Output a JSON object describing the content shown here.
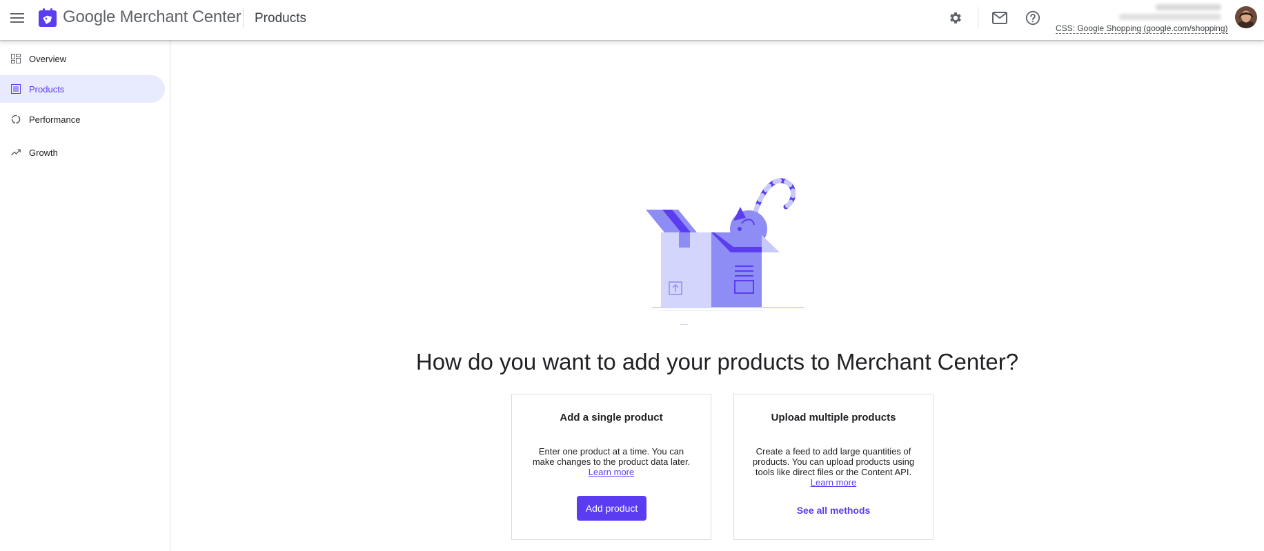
{
  "header": {
    "brand": "Google Merchant Center",
    "page_title": "Products",
    "account_css": "CSS: Google Shopping (google.com/shopping)"
  },
  "icons": {
    "menu": "menu-icon",
    "logo": "merchant-center-logo-icon",
    "settings": "gear-icon",
    "mail": "mail-icon",
    "help": "help-icon"
  },
  "sidebar": {
    "items": [
      {
        "label": "Overview",
        "icon": "dashboard-icon",
        "active": false
      },
      {
        "label": "Products",
        "icon": "list-icon",
        "active": true
      },
      {
        "label": "Performance",
        "icon": "donut-chart-icon",
        "active": false
      },
      {
        "label": "Growth",
        "icon": "trending-up-icon",
        "active": false
      }
    ]
  },
  "main": {
    "headline": "How do you want to add your products to Merchant Center?",
    "cards": [
      {
        "title": "Add a single product",
        "description": "Enter one product at a time. You can make changes to the product data later.",
        "link": "Learn more",
        "action": "Add product"
      },
      {
        "title": "Upload multiple products",
        "description": "Create a feed to add large quantities of products. You can upload products using tools like direct files or the Content API.",
        "link": "Learn more",
        "action": "See all methods"
      }
    ]
  },
  "colors": {
    "accent": "#5b3cf0",
    "active_nav_bg": "#e8eafd",
    "illustration_light": "#c7c9fb",
    "illustration_mid": "#8e8cf5",
    "illustration_dark": "#5b3cf0"
  }
}
